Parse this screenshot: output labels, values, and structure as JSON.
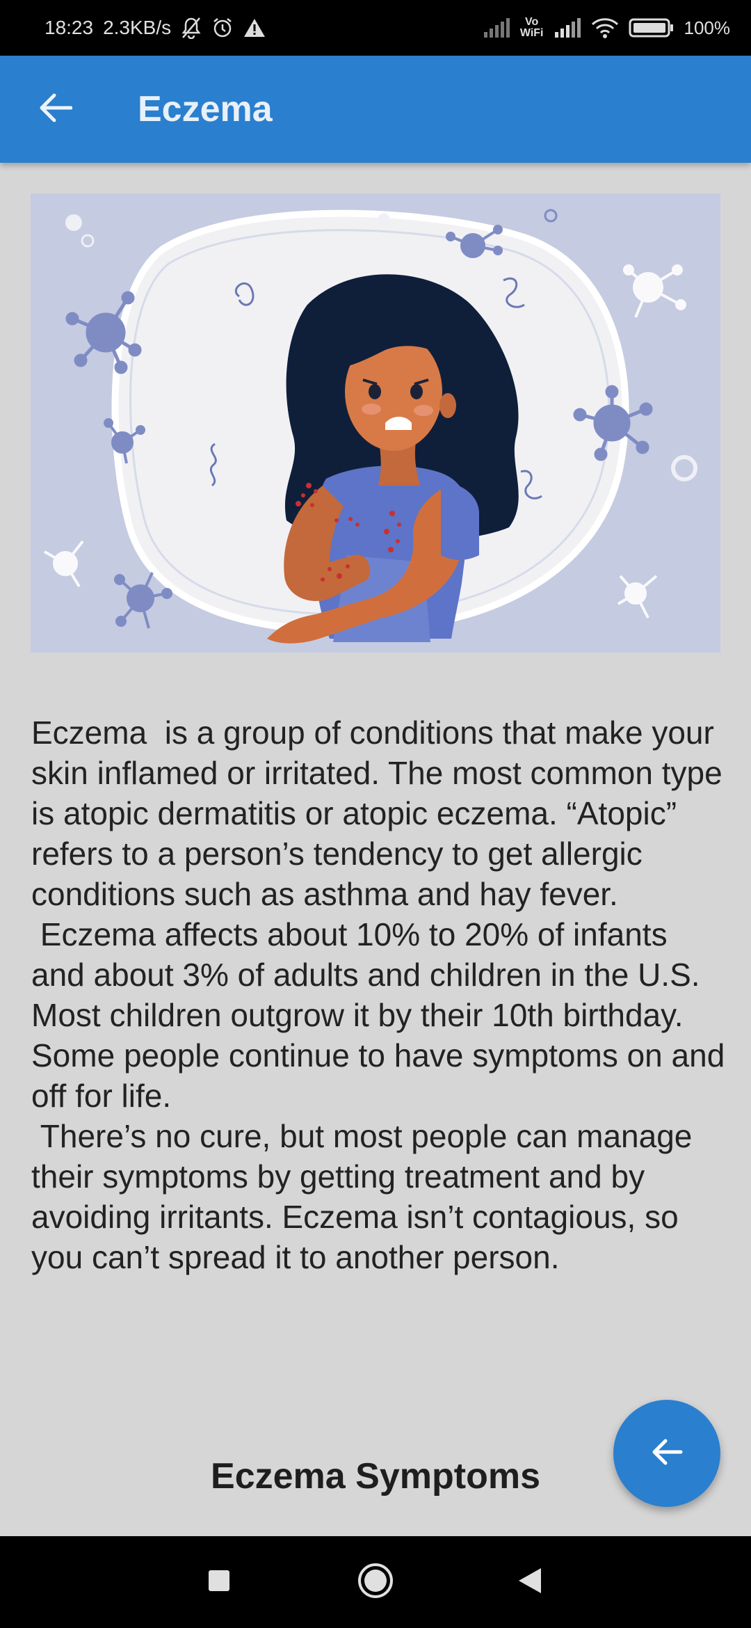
{
  "status_bar": {
    "time": "18:23",
    "speed": "2.3KB/s",
    "battery": "100%",
    "vowifi": "Vo\nWiFi",
    "icons": [
      "mute-bell-icon",
      "alarm-icon",
      "warning-icon",
      "signal-icon",
      "vowifi-icon",
      "signal-icon",
      "wifi-icon",
      "battery-icon"
    ]
  },
  "app_bar": {
    "title": "Eczema",
    "back_icon": "arrow-left-icon",
    "color": "#2a7fce"
  },
  "hero_image": {
    "subject": "eczema-illustration"
  },
  "content": {
    "body": "Eczema  is a group of conditions that make your skin inflamed or irritated. The most common type is atopic dermatitis or atopic eczema. “Atopic” refers to a person’s tendency to get allergic conditions such as asthma and hay fever.\n Eczema affects about 10% to 20% of infants and about 3% of adults and children in the U.S. Most children outgrow it by their 10th birthday. Some people continue to have symptoms on and off for life.\n There’s no cure, but most people can manage their symptoms by getting treatment and by avoiding irritants. Eczema isn’t contagious, so you can’t spread it to another person.",
    "section_heading": "Eczema Symptoms"
  },
  "fab": {
    "icon": "arrow-left-icon"
  },
  "nav_bar": {
    "buttons": [
      "recents-square-icon",
      "home-circle-icon",
      "back-triangle-icon"
    ]
  }
}
